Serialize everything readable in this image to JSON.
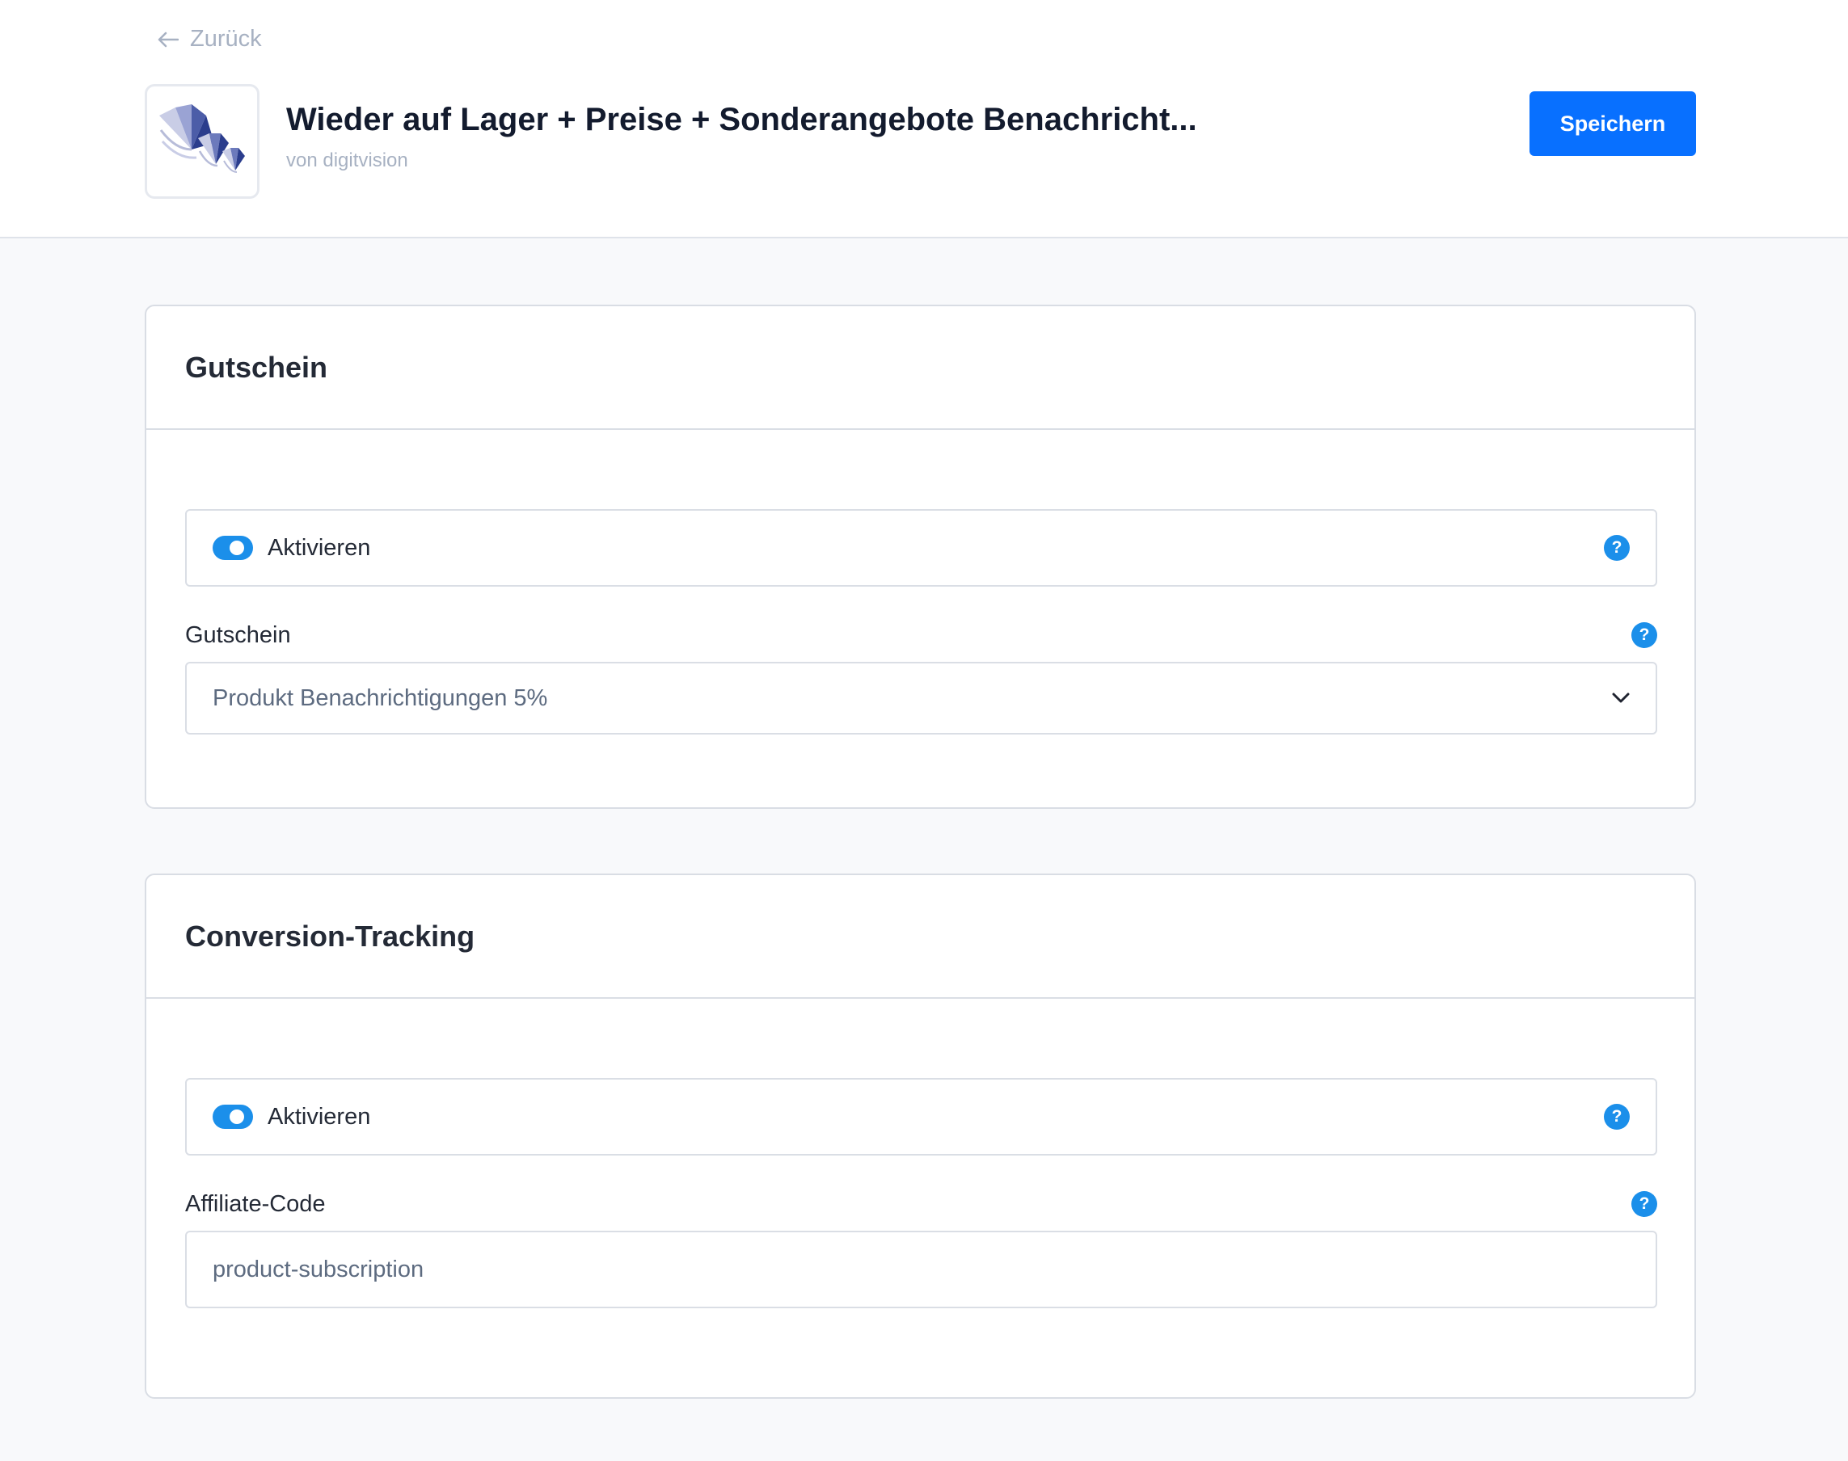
{
  "header": {
    "back_label": "Zurück",
    "app_title": "Wieder auf Lager + Preise + Sonderangebote Benachricht...",
    "app_vendor": "von digitvision",
    "save_label": "Speichern"
  },
  "coupon_section": {
    "title": "Gutschein",
    "toggle_label": "Aktivieren",
    "toggle_on": true,
    "field_label": "Gutschein",
    "selected_value": "Produkt Benachrichtigungen 5%"
  },
  "tracking_section": {
    "title": "Conversion-Tracking",
    "toggle_label": "Aktivieren",
    "toggle_on": true,
    "field_label": "Affiliate-Code",
    "input_value": "product-subscription"
  },
  "icons": {
    "back": "arrow-left-icon",
    "help": "question-mark-icon",
    "dropdown": "chevron-down-icon",
    "logo": "digitvision-logo"
  },
  "colors": {
    "accent": "#0870ff",
    "toggle": "#1b8fea",
    "muted_text": "#a7b1c2",
    "page_bg": "#f8f9fb"
  }
}
